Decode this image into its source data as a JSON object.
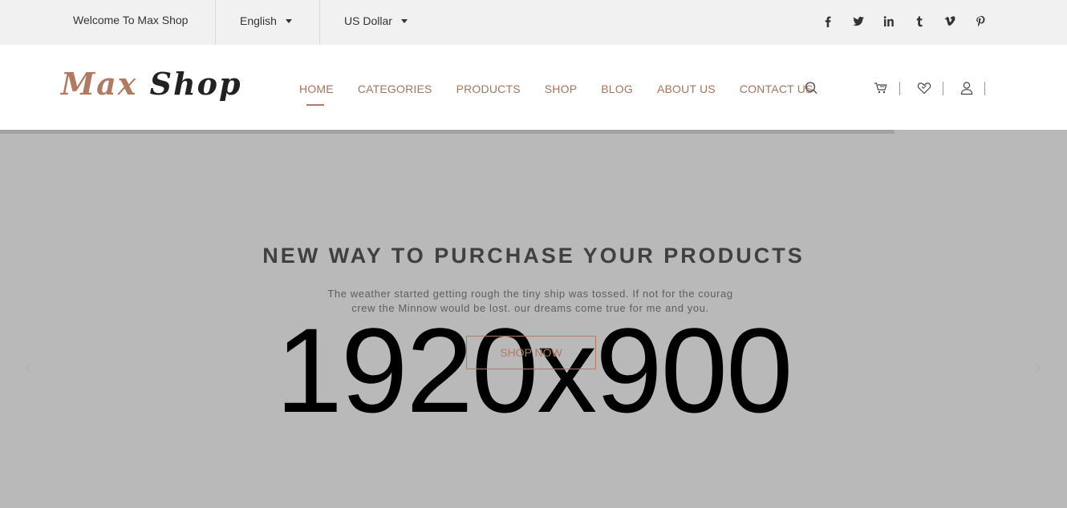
{
  "topbar": {
    "welcome": "Welcome To Max Shop",
    "language": "English",
    "currency": "US Dollar",
    "social": [
      "facebook-icon",
      "twitter-icon",
      "linkedin-icon",
      "tumblr-icon",
      "vimeo-icon",
      "pinterest-icon"
    ]
  },
  "header": {
    "logo_part1": "Max",
    "logo_part2": "Shop",
    "nav": [
      "HOME",
      "CATEGORIES",
      "PRODUCTS",
      "SHOP",
      "BLOG",
      "ABOUT US",
      "CONTACT US"
    ],
    "active_nav": "HOME",
    "icons": [
      "search-icon",
      "cart-icon",
      "heart-icon",
      "user-icon"
    ]
  },
  "hero": {
    "title": "NEW WAY TO PURCHASE YOUR PRODUCTS",
    "text_line1": "The weather started getting rough the tiny ship was tossed. If not for the courag",
    "text_line2": "crew the Minnow would be lost. our dreams come true for me and you.",
    "placeholder": "1920x900",
    "button": "SHOP NOW"
  },
  "colors": {
    "accent": "#b07a63",
    "topbar_bg": "#f1f1f1",
    "hero_bg": "#b9b9b9"
  }
}
